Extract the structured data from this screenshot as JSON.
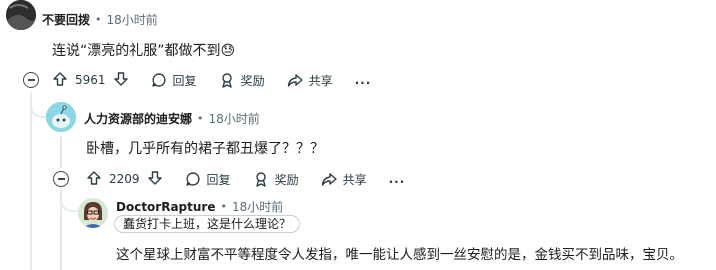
{
  "comments": [
    {
      "author": "不要回拨",
      "separator": "•",
      "time": "18小时前",
      "body": "连说“漂亮的礼服”都做不到😓",
      "votes": "5961",
      "reply_label": "回复",
      "award_label": "奖励",
      "share_label": "共享",
      "more_label": "..."
    },
    {
      "author": "人力资源部的迪安娜",
      "separator": "•",
      "time": "18小时前",
      "body": "卧槽，几乎所有的裙子都丑爆了？？？",
      "votes": "2209",
      "reply_label": "回复",
      "award_label": "奖励",
      "share_label": "共享",
      "more_label": "..."
    },
    {
      "author": "DoctorRapture",
      "separator": "•",
      "time": "18小时前",
      "flair": "蠢货打卡上班，这是什么理论？",
      "body": "这个星球上财富不平等程度令人发指，唯一能让人感到一丝安慰的是，金钱买不到品味，宝贝。"
    }
  ],
  "colors": {
    "thread_line": "#e5ebee",
    "meta_gray": "#576f76",
    "text": "#1c1c1c"
  }
}
